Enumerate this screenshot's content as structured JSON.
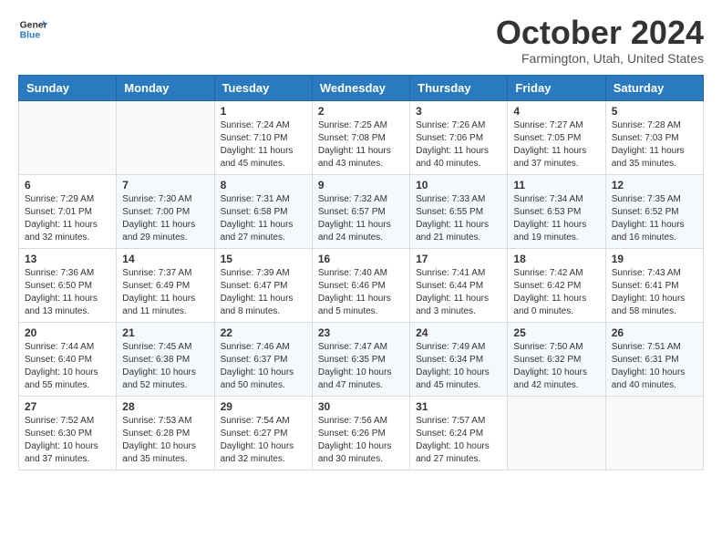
{
  "header": {
    "logo_line1": "General",
    "logo_line2": "Blue",
    "month_title": "October 2024",
    "location": "Farmington, Utah, United States"
  },
  "days_of_week": [
    "Sunday",
    "Monday",
    "Tuesday",
    "Wednesday",
    "Thursday",
    "Friday",
    "Saturday"
  ],
  "weeks": [
    [
      {
        "num": "",
        "sunrise": "",
        "sunset": "",
        "daylight": ""
      },
      {
        "num": "",
        "sunrise": "",
        "sunset": "",
        "daylight": ""
      },
      {
        "num": "1",
        "sunrise": "Sunrise: 7:24 AM",
        "sunset": "Sunset: 7:10 PM",
        "daylight": "Daylight: 11 hours and 45 minutes."
      },
      {
        "num": "2",
        "sunrise": "Sunrise: 7:25 AM",
        "sunset": "Sunset: 7:08 PM",
        "daylight": "Daylight: 11 hours and 43 minutes."
      },
      {
        "num": "3",
        "sunrise": "Sunrise: 7:26 AM",
        "sunset": "Sunset: 7:06 PM",
        "daylight": "Daylight: 11 hours and 40 minutes."
      },
      {
        "num": "4",
        "sunrise": "Sunrise: 7:27 AM",
        "sunset": "Sunset: 7:05 PM",
        "daylight": "Daylight: 11 hours and 37 minutes."
      },
      {
        "num": "5",
        "sunrise": "Sunrise: 7:28 AM",
        "sunset": "Sunset: 7:03 PM",
        "daylight": "Daylight: 11 hours and 35 minutes."
      }
    ],
    [
      {
        "num": "6",
        "sunrise": "Sunrise: 7:29 AM",
        "sunset": "Sunset: 7:01 PM",
        "daylight": "Daylight: 11 hours and 32 minutes."
      },
      {
        "num": "7",
        "sunrise": "Sunrise: 7:30 AM",
        "sunset": "Sunset: 7:00 PM",
        "daylight": "Daylight: 11 hours and 29 minutes."
      },
      {
        "num": "8",
        "sunrise": "Sunrise: 7:31 AM",
        "sunset": "Sunset: 6:58 PM",
        "daylight": "Daylight: 11 hours and 27 minutes."
      },
      {
        "num": "9",
        "sunrise": "Sunrise: 7:32 AM",
        "sunset": "Sunset: 6:57 PM",
        "daylight": "Daylight: 11 hours and 24 minutes."
      },
      {
        "num": "10",
        "sunrise": "Sunrise: 7:33 AM",
        "sunset": "Sunset: 6:55 PM",
        "daylight": "Daylight: 11 hours and 21 minutes."
      },
      {
        "num": "11",
        "sunrise": "Sunrise: 7:34 AM",
        "sunset": "Sunset: 6:53 PM",
        "daylight": "Daylight: 11 hours and 19 minutes."
      },
      {
        "num": "12",
        "sunrise": "Sunrise: 7:35 AM",
        "sunset": "Sunset: 6:52 PM",
        "daylight": "Daylight: 11 hours and 16 minutes."
      }
    ],
    [
      {
        "num": "13",
        "sunrise": "Sunrise: 7:36 AM",
        "sunset": "Sunset: 6:50 PM",
        "daylight": "Daylight: 11 hours and 13 minutes."
      },
      {
        "num": "14",
        "sunrise": "Sunrise: 7:37 AM",
        "sunset": "Sunset: 6:49 PM",
        "daylight": "Daylight: 11 hours and 11 minutes."
      },
      {
        "num": "15",
        "sunrise": "Sunrise: 7:39 AM",
        "sunset": "Sunset: 6:47 PM",
        "daylight": "Daylight: 11 hours and 8 minutes."
      },
      {
        "num": "16",
        "sunrise": "Sunrise: 7:40 AM",
        "sunset": "Sunset: 6:46 PM",
        "daylight": "Daylight: 11 hours and 5 minutes."
      },
      {
        "num": "17",
        "sunrise": "Sunrise: 7:41 AM",
        "sunset": "Sunset: 6:44 PM",
        "daylight": "Daylight: 11 hours and 3 minutes."
      },
      {
        "num": "18",
        "sunrise": "Sunrise: 7:42 AM",
        "sunset": "Sunset: 6:42 PM",
        "daylight": "Daylight: 11 hours and 0 minutes."
      },
      {
        "num": "19",
        "sunrise": "Sunrise: 7:43 AM",
        "sunset": "Sunset: 6:41 PM",
        "daylight": "Daylight: 10 hours and 58 minutes."
      }
    ],
    [
      {
        "num": "20",
        "sunrise": "Sunrise: 7:44 AM",
        "sunset": "Sunset: 6:40 PM",
        "daylight": "Daylight: 10 hours and 55 minutes."
      },
      {
        "num": "21",
        "sunrise": "Sunrise: 7:45 AM",
        "sunset": "Sunset: 6:38 PM",
        "daylight": "Daylight: 10 hours and 52 minutes."
      },
      {
        "num": "22",
        "sunrise": "Sunrise: 7:46 AM",
        "sunset": "Sunset: 6:37 PM",
        "daylight": "Daylight: 10 hours and 50 minutes."
      },
      {
        "num": "23",
        "sunrise": "Sunrise: 7:47 AM",
        "sunset": "Sunset: 6:35 PM",
        "daylight": "Daylight: 10 hours and 47 minutes."
      },
      {
        "num": "24",
        "sunrise": "Sunrise: 7:49 AM",
        "sunset": "Sunset: 6:34 PM",
        "daylight": "Daylight: 10 hours and 45 minutes."
      },
      {
        "num": "25",
        "sunrise": "Sunrise: 7:50 AM",
        "sunset": "Sunset: 6:32 PM",
        "daylight": "Daylight: 10 hours and 42 minutes."
      },
      {
        "num": "26",
        "sunrise": "Sunrise: 7:51 AM",
        "sunset": "Sunset: 6:31 PM",
        "daylight": "Daylight: 10 hours and 40 minutes."
      }
    ],
    [
      {
        "num": "27",
        "sunrise": "Sunrise: 7:52 AM",
        "sunset": "Sunset: 6:30 PM",
        "daylight": "Daylight: 10 hours and 37 minutes."
      },
      {
        "num": "28",
        "sunrise": "Sunrise: 7:53 AM",
        "sunset": "Sunset: 6:28 PM",
        "daylight": "Daylight: 10 hours and 35 minutes."
      },
      {
        "num": "29",
        "sunrise": "Sunrise: 7:54 AM",
        "sunset": "Sunset: 6:27 PM",
        "daylight": "Daylight: 10 hours and 32 minutes."
      },
      {
        "num": "30",
        "sunrise": "Sunrise: 7:56 AM",
        "sunset": "Sunset: 6:26 PM",
        "daylight": "Daylight: 10 hours and 30 minutes."
      },
      {
        "num": "31",
        "sunrise": "Sunrise: 7:57 AM",
        "sunset": "Sunset: 6:24 PM",
        "daylight": "Daylight: 10 hours and 27 minutes."
      },
      {
        "num": "",
        "sunrise": "",
        "sunset": "",
        "daylight": ""
      },
      {
        "num": "",
        "sunrise": "",
        "sunset": "",
        "daylight": ""
      }
    ]
  ]
}
